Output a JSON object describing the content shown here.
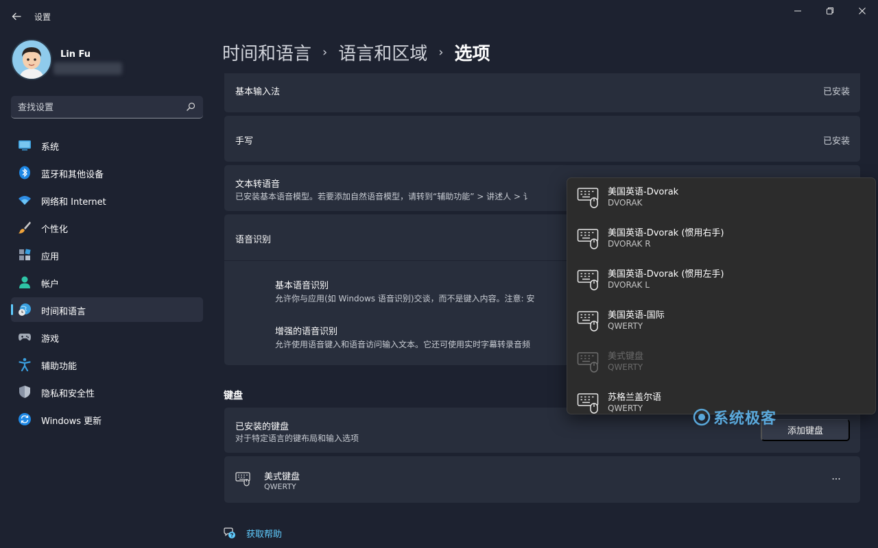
{
  "window": {
    "app_title": "设置",
    "back_icon": "back-arrow-icon",
    "minimize_icon": "minimize-icon",
    "maximize_icon": "maximize-icon",
    "close_icon": "close-icon"
  },
  "profile": {
    "name": "Lin Fu"
  },
  "search": {
    "placeholder": "查找设置",
    "icon": "search-icon"
  },
  "sidebar": {
    "items": [
      {
        "label": "系统",
        "icon": "system-icon",
        "active": false
      },
      {
        "label": "蓝牙和其他设备",
        "icon": "bluetooth-icon",
        "active": false
      },
      {
        "label": "网络和 Internet",
        "icon": "wifi-icon",
        "active": false
      },
      {
        "label": "个性化",
        "icon": "brush-icon",
        "active": false
      },
      {
        "label": "应用",
        "icon": "apps-icon",
        "active": false
      },
      {
        "label": "帐户",
        "icon": "account-icon",
        "active": false
      },
      {
        "label": "时间和语言",
        "icon": "time-language-icon",
        "active": true
      },
      {
        "label": "游戏",
        "icon": "gamepad-icon",
        "active": false
      },
      {
        "label": "辅助功能",
        "icon": "accessibility-icon",
        "active": false
      },
      {
        "label": "隐私和安全性",
        "icon": "shield-icon",
        "active": false
      },
      {
        "label": "Windows 更新",
        "icon": "update-icon",
        "active": false
      }
    ]
  },
  "breadcrumb": {
    "part1": "时间和语言",
    "part2": "语言和区域",
    "current": "选项",
    "sep": "›"
  },
  "features": {
    "basic_input": {
      "title": "基本输入法",
      "status": "已安装"
    },
    "handwriting": {
      "title": "手写",
      "status": "已安装"
    },
    "tts": {
      "title": "文本转语音",
      "desc": "已安装基本语音模型。若要添加自然语音模型，请转到“辅助功能” > 讲述人 > 讠"
    },
    "speech": {
      "title": "语音识别",
      "basic_title": "基本语音识别",
      "basic_desc": "允许你与应用(如 Windows 语音识别)交谈，而不是键入内容。注意: 安",
      "enhanced_title": "增强的语音识别",
      "enhanced_desc": "允许使用语音键入和语音访问输入文本。它还可使用实时字幕转录音频"
    }
  },
  "keyboard": {
    "section_label": "键盘",
    "installed_title": "已安装的键盘",
    "installed_desc": "对于特定语言的键布局和输入选项",
    "add_button": "添加键盘",
    "item": {
      "name": "美式键盘",
      "layout": "QWERTY",
      "icon": "keyboard-icon",
      "more": "···"
    }
  },
  "flyout": {
    "items": [
      {
        "name": "美国英语-Dvorak",
        "layout": "DVORAK",
        "disabled": false
      },
      {
        "name": "美国英语-Dvorak (惯用右手)",
        "layout": "DVORAK R",
        "disabled": false
      },
      {
        "name": "美国英语-Dvorak (惯用左手)",
        "layout": "DVORAK L",
        "disabled": false
      },
      {
        "name": "美国英语-国际",
        "layout": "QWERTY",
        "disabled": false
      },
      {
        "name": "美式键盘",
        "layout": "QWERTY",
        "disabled": true
      },
      {
        "name": "苏格兰盖尔语",
        "layout": "QWERTY",
        "disabled": false
      }
    ]
  },
  "help": {
    "label": "获取帮助",
    "icon": "help-chat-icon"
  },
  "watermark": {
    "text": "系统极客"
  },
  "colors": {
    "accent": "#60cdff",
    "background": "#1d2230",
    "card": "#282e3c",
    "flyout": "#2c2c2c"
  }
}
